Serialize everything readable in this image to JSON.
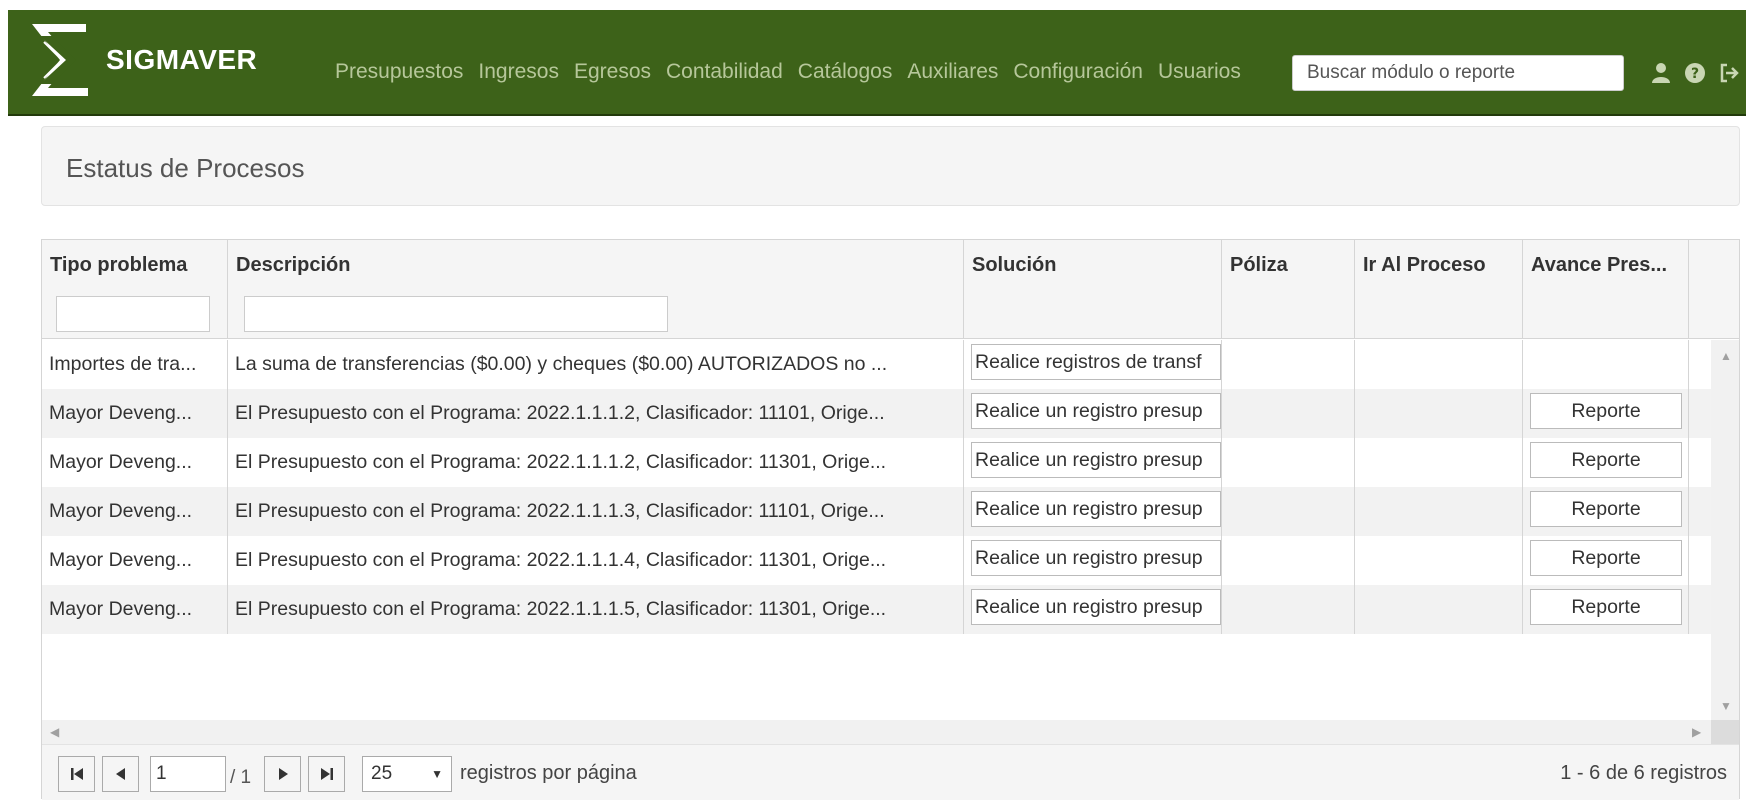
{
  "app": {
    "brand": "SIGMAVER",
    "nav": [
      "Presupuestos",
      "Ingresos",
      "Egresos",
      "Contabilidad",
      "Catálogos",
      "Auxiliares",
      "Configuración",
      "Usuarios"
    ],
    "search_placeholder": "Buscar módulo o reporte",
    "icons": [
      "user-icon",
      "help-icon",
      "logout-icon"
    ],
    "colors": {
      "navbar": "#3d6219",
      "nav_text": "#b6c79a"
    }
  },
  "page": {
    "title": "Estatus de Procesos"
  },
  "grid": {
    "columns": [
      "Tipo problema",
      "Descripción",
      "Solución",
      "Póliza",
      "Ir Al Proceso",
      "Avance Pres..."
    ],
    "rows": [
      {
        "tipo": "Importes de tra...",
        "descripcion": "La suma de transferencias ($0.00) y cheques ($0.00) AUTORIZADOS no ...",
        "solucion": "Realice registros de transf",
        "poliza": "",
        "ir_al_proceso": "",
        "avance": ""
      },
      {
        "tipo": "Mayor Deveng...",
        "descripcion": "El Presupuesto con el Programa: 2022.1.1.1.2, Clasificador: 11101, Orige...",
        "solucion": "Realice un registro presup",
        "poliza": "",
        "ir_al_proceso": "",
        "avance": "Reporte"
      },
      {
        "tipo": "Mayor Deveng...",
        "descripcion": "El Presupuesto con el Programa: 2022.1.1.1.2, Clasificador: 11301, Orige...",
        "solucion": "Realice un registro presup",
        "poliza": "",
        "ir_al_proceso": "",
        "avance": "Reporte"
      },
      {
        "tipo": "Mayor Deveng...",
        "descripcion": "El Presupuesto con el Programa: 2022.1.1.1.3, Clasificador: 11101, Orige...",
        "solucion": "Realice un registro presup",
        "poliza": "",
        "ir_al_proceso": "",
        "avance": "Reporte"
      },
      {
        "tipo": "Mayor Deveng...",
        "descripcion": "El Presupuesto con el Programa: 2022.1.1.1.4, Clasificador: 11301, Orige...",
        "solucion": "Realice un registro presup",
        "poliza": "",
        "ir_al_proceso": "",
        "avance": "Reporte"
      },
      {
        "tipo": "Mayor Deveng...",
        "descripcion": "El Presupuesto con el Programa: 2022.1.1.1.5, Clasificador: 11301, Orige...",
        "solucion": "Realice un registro presup",
        "poliza": "",
        "ir_al_proceso": "",
        "avance": "Reporte"
      }
    ]
  },
  "pager": {
    "current_page": "1",
    "total_pages": "/ 1",
    "page_size": "25",
    "per_page_label": "registros por página",
    "records_label": "1 - 6 de 6 registros"
  }
}
